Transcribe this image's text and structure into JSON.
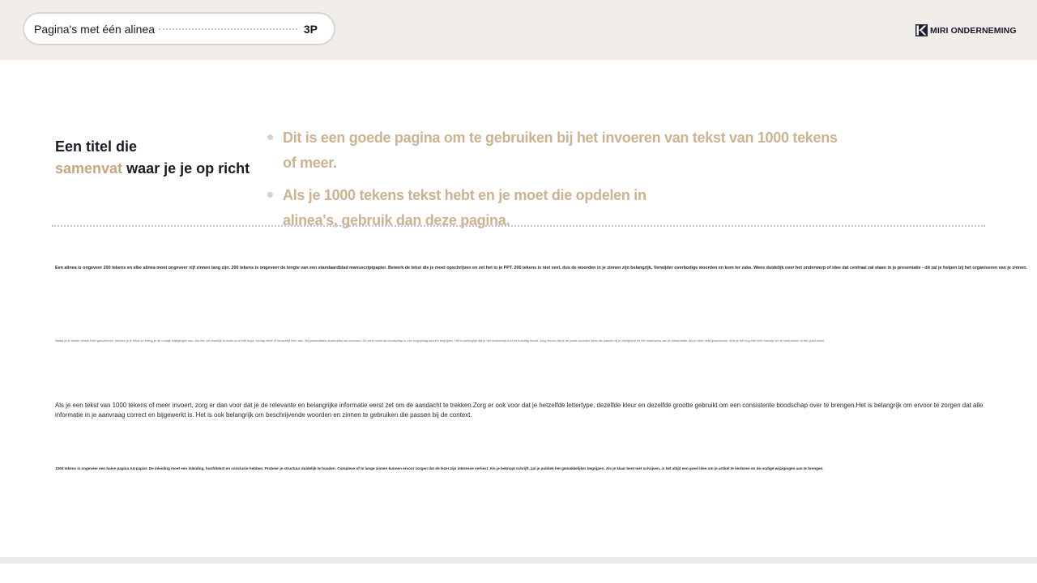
{
  "header": {
    "section_title": "Pagina's met één alinea",
    "page_label": "3P",
    "brand_name": "MIRI ONDERNEMING"
  },
  "main": {
    "title_line1": "Een titel die",
    "title_accent": "samenvat",
    "title_rest": " waar je je op richt",
    "bullets": [
      "Dit is een goede pagina om te gebruiken bij het invoeren van tekst van 1000 tekens of meer.",
      "Als je 1000 tekens tekst hebt en je moet die opdelen in alinea's, gebruik dan deze pagina."
    ]
  },
  "paragraphs": [
    "Een alinea is ongeveer 200 tekens en elke alinea moet ongeveer vijf zinnen lang zijn. 200 tekens is ongeveer de lengte van een standaardblad manuscriptpapier. Bewerk de tekst die je moet opschrijven en zet het in je PPT. 200 tekens is niet veel, dus de woorden in je zinnen zijn belangrijk. Verwijder overbodige woorden en kom ter zake. Wees duidelijk over het onderwerp of idee dat centraal zal staan in je presentatie - dit zal je helpen bij het organiseren van je zinnen.",
    "Nadat je je eerste versie hebt geschreven, herlees je je tekst en breng je de nodige wijzigingen aan. Als een zin moeilijk te lezen is of niet loopt, schrap deze of herschrijf hem dan. Bij presentaties draait alles om eenvoud. De lezer moet de boodschap in een oogopslag kunnen begrijpen. Het is belangrijk dat je het onderwerp kort en krachtig houdt. Zorg ervoor dat je de juiste woorden kiest die passen bij je doelgroep en het onderwerp van je presentatie. Als je alles hebt geschreven, lees je het nog één keer hardop om te controleren of het goed klinkt.",
    "Als je een tekst van 1000 tekens of meer invoert, zorg er dan voor dat je de relevante en belangrijke informatie eerst zet om de aandacht te trekken.Zorg er ook voor dat je hetzelfde lettertype, dezelfde kleur en dezelfde grootte gebruikt om een consistente boodschap over te brengen.Het is belangrijk om ervoor te zorgen dat alle informatie in je aanvraag correct en bijgewerkt is. Het is ook belangrijk om beschrijvende woorden en zinnen te gebruiken die passen bij de context.",
    "1000 tekens is ongeveer een halve pagina A4-papier. De inleiding moet een inleiding, hoofdtekst en conclusie hebben. Probeer je structuur duidelijk te houden. Complexe of te lange zinnen kunnen ervoor zorgen dat de lezer zijn interesse verliest. Als je beknopt schrijft, zal je publiek het gemakkelijker begrijpen. Als je klaar bent met schrijven, is het altijd een goed idee om je artikel te herlezen en de nodige wijzigingen aan te brengen."
  ],
  "colors": {
    "accent": "#c4a780",
    "bullet_text": "#cbb292",
    "divider": "#c9b6df",
    "header_bg": "#f1eee9"
  },
  "icons": {
    "brand_logo": "miri-logo-icon",
    "bullet": "bullet-dot-icon"
  }
}
